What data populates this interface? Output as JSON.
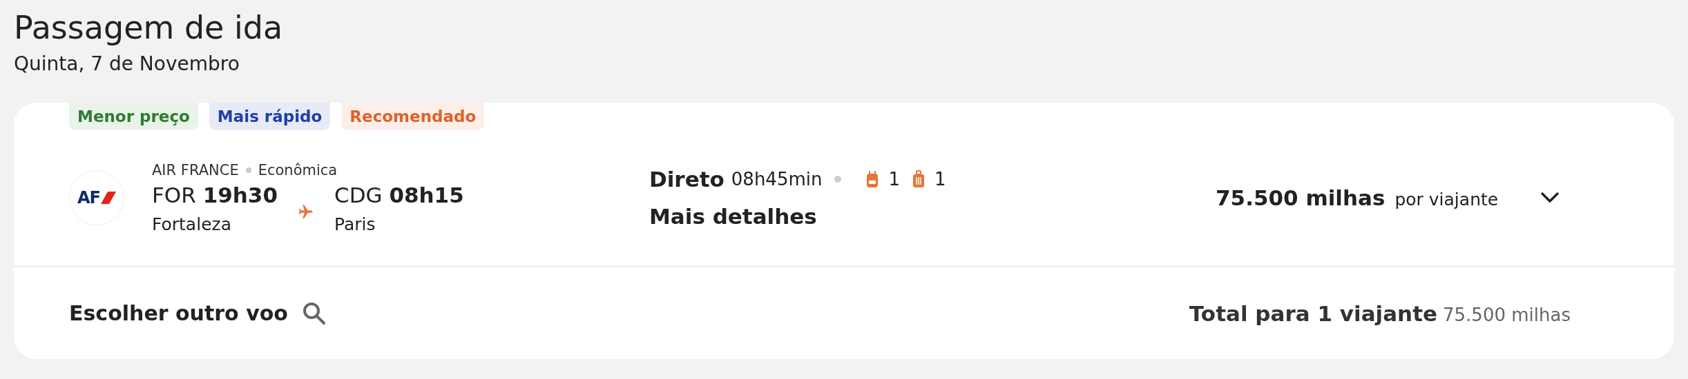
{
  "header": {
    "title": "Passagem de ida",
    "date": "Quinta, 7 de Novembro"
  },
  "tags": [
    {
      "label": "Menor preço",
      "color": "#2e7d32"
    },
    {
      "label": "Mais rápido",
      "color": "#1e3fa8"
    },
    {
      "label": "Recomendado",
      "color": "#e0622a"
    }
  ],
  "flight": {
    "airline": "AIR FRANCE",
    "logo_text": "AF",
    "cabin": "Econômica",
    "origin": {
      "code": "FOR",
      "time": "19h30",
      "city": "Fortaleza"
    },
    "destination": {
      "code": "CDG",
      "time": "08h15",
      "city": "Paris"
    },
    "stops": "Direto",
    "duration": "08h45min",
    "baggage": [
      {
        "kind": "backpack",
        "count": "1"
      },
      {
        "kind": "suitcase",
        "count": "1"
      }
    ],
    "details_link": "Mais detalhes",
    "price": "75.500 milhas",
    "price_unit": "por viajante",
    "expanded": false
  },
  "footer": {
    "other_flight": "Escolher outro voo",
    "total_label": "Total para 1 viajante",
    "total_value": "75.500 milhas"
  }
}
